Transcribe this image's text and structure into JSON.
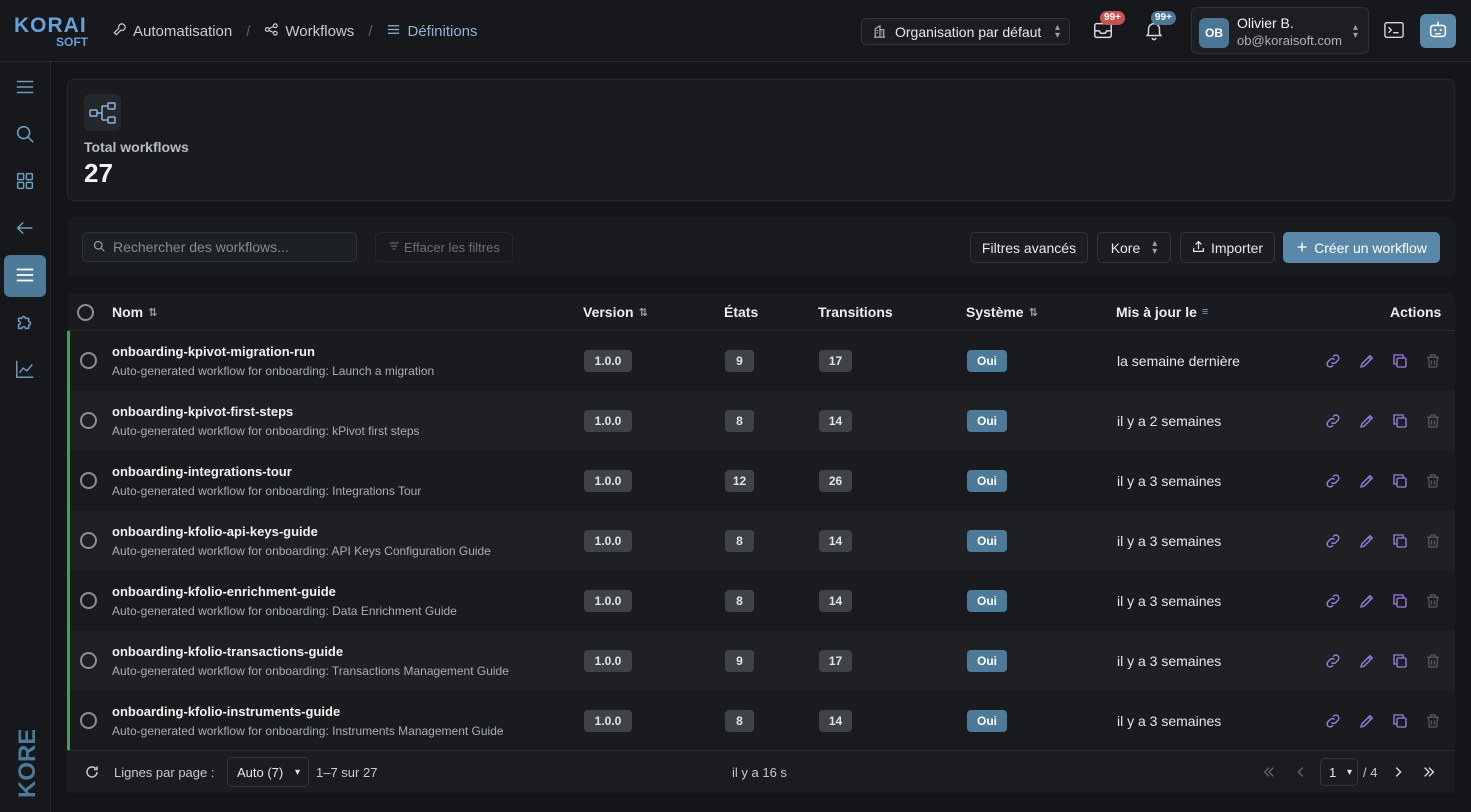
{
  "logo": {
    "top": "KORAI",
    "bottom": "SOFT"
  },
  "breadcrumb": [
    {
      "label": "Automatisation",
      "icon": "wrench-icon"
    },
    {
      "label": "Workflows",
      "icon": "share-icon"
    },
    {
      "label": "Définitions",
      "icon": "list-icon"
    }
  ],
  "breadcrumb_sep": "/",
  "org_selector": {
    "value": "Organisation par défaut"
  },
  "notifications": {
    "inbox_badge": "99+",
    "bell_badge": "99+"
  },
  "user": {
    "initials": "OB",
    "name": "Olivier B.",
    "email": "ob@koraisoft.com"
  },
  "sidebar": {
    "brand": "KORE"
  },
  "stats": {
    "label": "Total workflows",
    "value": "27"
  },
  "toolbar": {
    "search_placeholder": "Rechercher des workflows...",
    "clear_filters": "Effacer les filtres",
    "advanced_filters": "Filtres avancés",
    "source_filter": "Kore",
    "import": "Importer",
    "create": "Créer un workflow"
  },
  "table": {
    "columns": [
      "Nom",
      "Version",
      "États",
      "Transitions",
      "Système",
      "Mis à jour le",
      "Actions"
    ],
    "rows": [
      {
        "name": "onboarding-kpivot-migration-run",
        "desc": "Auto-generated workflow for onboarding: Launch a migration",
        "version": "1.0.0",
        "states": "9",
        "transitions": "17",
        "system": "Oui",
        "updated": "la semaine dernière"
      },
      {
        "name": "onboarding-kpivot-first-steps",
        "desc": "Auto-generated workflow for onboarding: kPivot first steps",
        "version": "1.0.0",
        "states": "8",
        "transitions": "14",
        "system": "Oui",
        "updated": "il y a 2 semaines"
      },
      {
        "name": "onboarding-integrations-tour",
        "desc": "Auto-generated workflow for onboarding: Integrations Tour",
        "version": "1.0.0",
        "states": "12",
        "transitions": "26",
        "system": "Oui",
        "updated": "il y a 3 semaines"
      },
      {
        "name": "onboarding-kfolio-api-keys-guide",
        "desc": "Auto-generated workflow for onboarding: API Keys Configuration Guide",
        "version": "1.0.0",
        "states": "8",
        "transitions": "14",
        "system": "Oui",
        "updated": "il y a 3 semaines"
      },
      {
        "name": "onboarding-kfolio-enrichment-guide",
        "desc": "Auto-generated workflow for onboarding: Data Enrichment Guide",
        "version": "1.0.0",
        "states": "8",
        "transitions": "14",
        "system": "Oui",
        "updated": "il y a 3 semaines"
      },
      {
        "name": "onboarding-kfolio-transactions-guide",
        "desc": "Auto-generated workflow for onboarding: Transactions Management Guide",
        "version": "1.0.0",
        "states": "9",
        "transitions": "17",
        "system": "Oui",
        "updated": "il y a 3 semaines"
      },
      {
        "name": "onboarding-kfolio-instruments-guide",
        "desc": "Auto-generated workflow for onboarding: Instruments Management Guide",
        "version": "1.0.0",
        "states": "8",
        "transitions": "14",
        "system": "Oui",
        "updated": "il y a 3 semaines"
      }
    ]
  },
  "footer": {
    "rows_label": "Lignes par page :",
    "rows_value": "Auto (7)",
    "range": "1–7 sur 27",
    "refreshed": "il y a 16 s",
    "page": "1",
    "total_pages": "/ 4"
  },
  "colors": {
    "accent": "#5a88a8",
    "system_badge": "#4d7a98",
    "row_marker": "#4b9a5a",
    "action_icon": "#9b7fe0",
    "danger_badge": "#c9514f"
  }
}
